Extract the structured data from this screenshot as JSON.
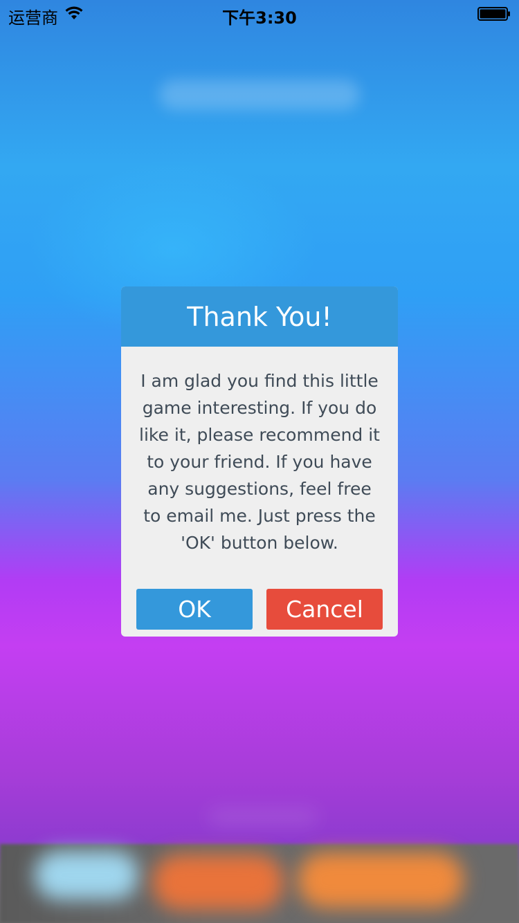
{
  "status_bar": {
    "carrier": "运营商",
    "time": "下午3:30",
    "icons": [
      "wifi-icon",
      "battery-icon"
    ]
  },
  "dialog": {
    "title": "Thank You!",
    "message": "I am glad you find this little game interesting. If you do like it, please recommend it to your friend. If you have any suggestions, feel free to email me. Just press the 'OK' button below.",
    "ok_label": "OK",
    "cancel_label": "Cancel"
  },
  "colors": {
    "header": "#3498db",
    "ok_button": "#3498db",
    "cancel_button": "#e74c3c",
    "dialog_background": "#efefef",
    "message_text": "#3f4b57"
  }
}
